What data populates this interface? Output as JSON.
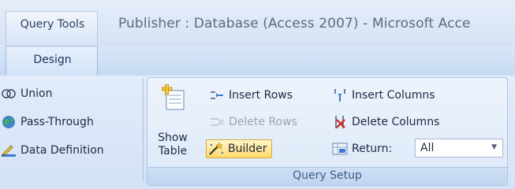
{
  "titlebar": {
    "context_tab": "Query Tools",
    "window_title": "Publisher : Database (Access 2007) - Microsoft Acce"
  },
  "ribbon_tabs": [
    {
      "label": "Design",
      "active": true
    }
  ],
  "left_group": {
    "items": [
      {
        "label": "Union",
        "icon": "union-icon"
      },
      {
        "label": "Pass-Through",
        "icon": "globe-icon"
      },
      {
        "label": "Data Definition",
        "icon": "pencil-ruler-icon"
      }
    ]
  },
  "query_setup": {
    "group_label": "Query Setup",
    "show_table": {
      "line1": "Show",
      "line2": "Table",
      "icon": "show-table-icon"
    },
    "insert_rows": {
      "label": "Insert Rows",
      "icon": "insert-rows-icon",
      "enabled": true
    },
    "delete_rows": {
      "label": "Delete Rows",
      "icon": "delete-rows-icon",
      "enabled": false
    },
    "builder": {
      "label": "Builder",
      "icon": "builder-wand-icon",
      "active": true
    },
    "insert_columns": {
      "label": "Insert Columns",
      "icon": "insert-columns-icon"
    },
    "delete_columns": {
      "label": "Delete Columns",
      "icon": "delete-columns-icon"
    },
    "return": {
      "label": "Return:",
      "icon": "return-top-values-icon",
      "value": "All"
    }
  },
  "colors": {
    "accent_active": "#ffd86b",
    "ribbon_bg": "#dde9f8",
    "group_label_text": "#3d5a87"
  }
}
